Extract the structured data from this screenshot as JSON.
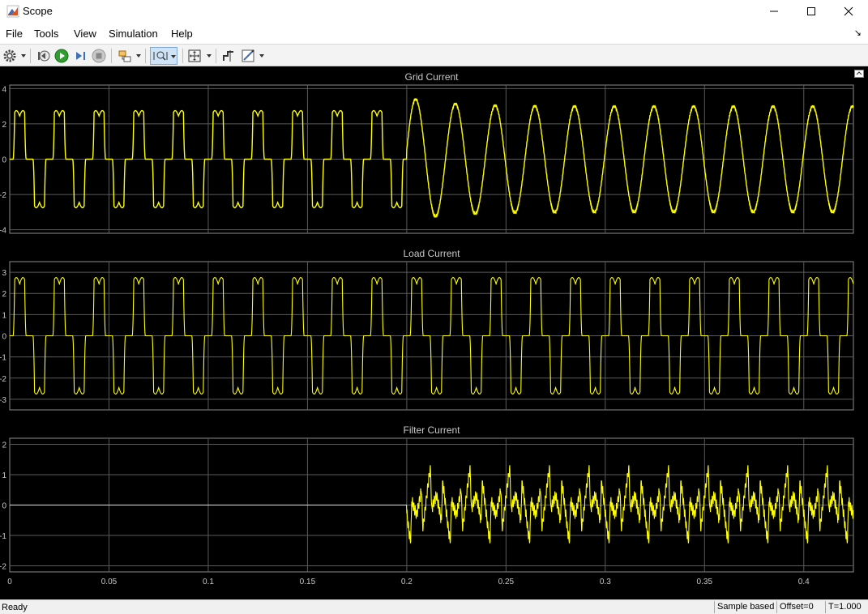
{
  "window": {
    "title": "Scope"
  },
  "menu": {
    "items": [
      "File",
      "Tools",
      "View",
      "Simulation",
      "Help"
    ]
  },
  "toolbar": {
    "icons": [
      "gear-icon",
      "step-back-icon",
      "run-icon",
      "step-forward-icon",
      "stop-icon",
      "highlight-block-icon",
      "zoom-x-icon",
      "fit-to-view-icon",
      "cursor-measurement-icon",
      "style-icon"
    ]
  },
  "colors": {
    "trace": "#ffff00",
    "axes_bg": "#000000",
    "grid": "#5a5a5a",
    "label": "#c8c8c8"
  },
  "status": {
    "text": "Ready",
    "mode": "Sample based",
    "offset": "Offset=0",
    "time": "T=1.000"
  },
  "chart_data": [
    {
      "type": "line",
      "title": "Grid Current",
      "x_ticks": [
        0,
        0.05,
        0.1,
        0.15,
        0.2,
        0.25,
        0.3,
        0.35,
        0.4
      ],
      "xlim": [
        0,
        0.425
      ],
      "ylim": [
        -4.2,
        4.2
      ],
      "y_ticks": [
        4,
        2,
        0,
        -2,
        -4
      ],
      "grid": true,
      "series": [
        {
          "description_segments": [
            {
              "x_range": [
                0,
                0.2
              ],
              "shape": "nonlinear rectifier load current",
              "peak": 2.7,
              "frequency_hz": 50
            },
            {
              "x_range": [
                0.2,
                0.425
              ],
              "shape": "sinusoid",
              "peak": 3.0,
              "first_peak": 3.5,
              "frequency_hz": 50
            }
          ]
        }
      ]
    },
    {
      "type": "line",
      "title": "Load Current",
      "x_ticks": [
        0,
        0.05,
        0.1,
        0.15,
        0.2,
        0.25,
        0.3,
        0.35,
        0.4
      ],
      "xlim": [
        0,
        0.425
      ],
      "ylim": [
        -3.5,
        3.5
      ],
      "y_ticks": [
        3,
        2,
        1,
        0,
        -1,
        -2,
        -3
      ],
      "grid": true,
      "series": [
        {
          "description_segments": [
            {
              "x_range": [
                0,
                0.425
              ],
              "shape": "nonlinear rectifier load current",
              "peak": 2.7,
              "frequency_hz": 50
            }
          ]
        }
      ]
    },
    {
      "type": "line",
      "title": "Filter Current",
      "x_ticks": [
        0,
        0.05,
        0.1,
        0.15,
        0.2,
        0.25,
        0.3,
        0.35,
        0.4
      ],
      "x_tick_labels": [
        "0",
        "0.05",
        "0.1",
        "0.15",
        "0.2",
        "0.25",
        "0.3",
        "0.35",
        "0.4"
      ],
      "xlim": [
        0,
        0.425
      ],
      "ylim": [
        -2.2,
        2.2
      ],
      "y_ticks": [
        2,
        1,
        0,
        -1,
        -2
      ],
      "grid": true,
      "series": [
        {
          "description_segments": [
            {
              "x_range": [
                0,
                0.2
              ],
              "shape": "zero",
              "value": 0
            },
            {
              "x_range": [
                0.2,
                0.425
              ],
              "shape": "harmonic compensation current",
              "amplitude": 1.7
            }
          ]
        }
      ]
    }
  ]
}
